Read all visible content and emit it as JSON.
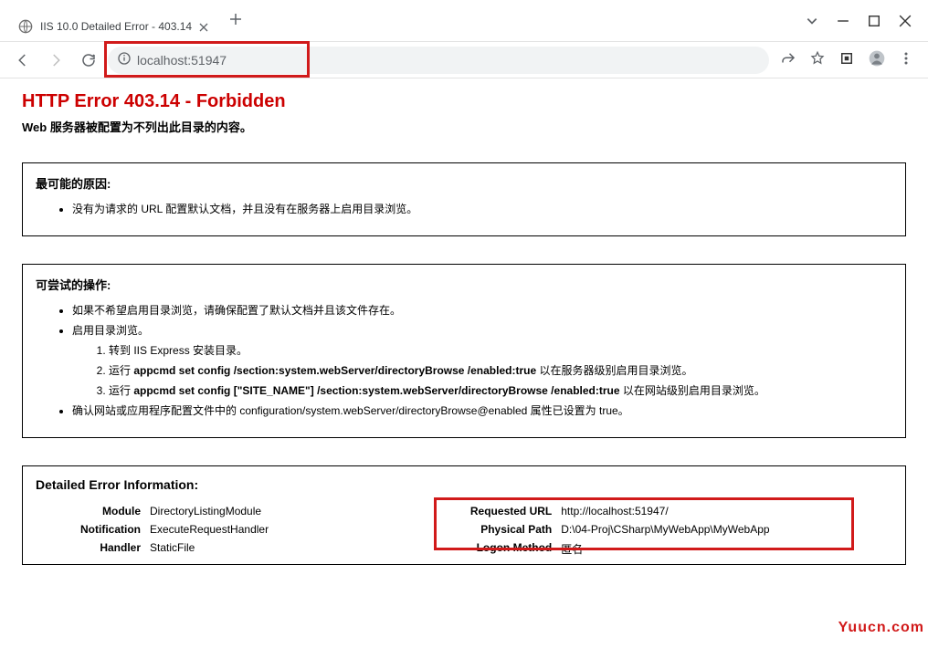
{
  "browser": {
    "tab_title": "IIS 10.0 Detailed Error - 403.14",
    "url": "localhost:51947"
  },
  "page": {
    "h1": "HTTP Error 403.14 - Forbidden",
    "subtitle": "Web 服务器被配置为不列出此目录的内容。",
    "causes": {
      "heading": "最可能的原因:",
      "items": [
        "没有为请求的 URL 配置默认文档，并且没有在服务器上启用目录浏览。"
      ]
    },
    "things_to_try": {
      "heading": "可尝试的操作:",
      "item1": "如果不希望启用目录浏览，请确保配置了默认文档并且该文件存在。",
      "item2": "启用目录浏览。",
      "sub1": "转到 IIS Express 安装目录。",
      "sub2a": "运行 ",
      "sub2b": "appcmd set config /section:system.webServer/directoryBrowse /enabled:true",
      "sub2c": " 以在服务器级别启用目录浏览。",
      "sub3a": "运行 ",
      "sub3b": "appcmd set config [\"SITE_NAME\"] /section:system.webServer/directoryBrowse /enabled:true",
      "sub3c": " 以在网站级别启用目录浏览。",
      "item3": "确认网站或应用程序配置文件中的 configuration/system.webServer/directoryBrowse@enabled 属性已设置为 true。"
    },
    "details": {
      "heading": "Detailed Error Information:",
      "left": [
        {
          "label": "Module",
          "value": "DirectoryListingModule"
        },
        {
          "label": "Notification",
          "value": "ExecuteRequestHandler"
        },
        {
          "label": "Handler",
          "value": "StaticFile"
        }
      ],
      "right": [
        {
          "label": "Requested URL",
          "value": "http://localhost:51947/"
        },
        {
          "label": "Physical Path",
          "value": "D:\\04-Proj\\CSharp\\MyWebApp\\MyWebApp"
        },
        {
          "label": "Logon Method",
          "value": "匿名"
        }
      ]
    }
  },
  "watermark": "Yuucn.com"
}
